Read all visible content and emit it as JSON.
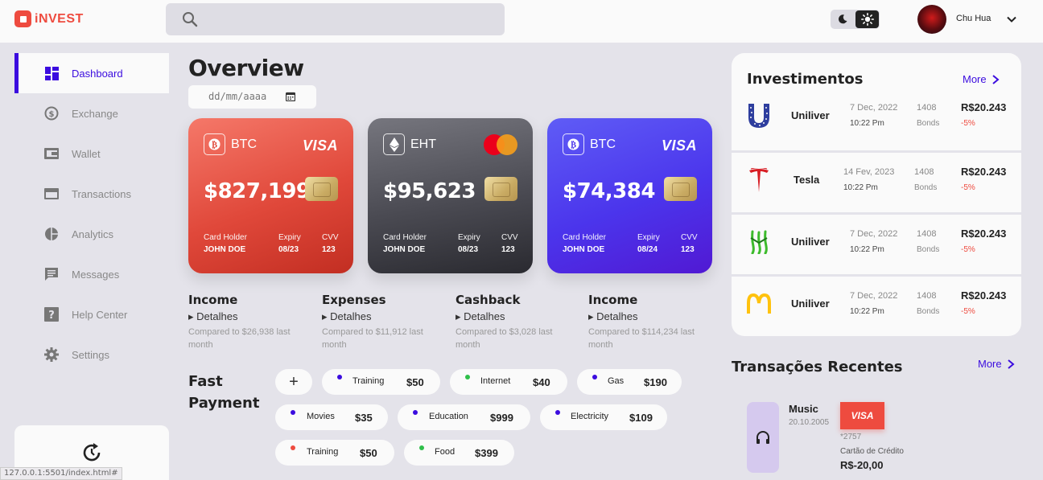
{
  "app": {
    "name": "iNVEST",
    "brand_color": "#ee4b3f",
    "accent_color": "#3b0cdf"
  },
  "header": {
    "user_name": "Chu Hua",
    "search_icon": "search-icon",
    "theme_icons": [
      "moon-icon",
      "sun-icon"
    ]
  },
  "sidebar": {
    "items": [
      {
        "label": "Dashboard",
        "icon": "dashboard-icon",
        "active": true
      },
      {
        "label": "Exchange",
        "icon": "exchange-icon"
      },
      {
        "label": "Wallet",
        "icon": "wallet-icon"
      },
      {
        "label": "Transactions",
        "icon": "card-icon"
      },
      {
        "label": "Analytics",
        "icon": "pie-chart-icon"
      },
      {
        "label": "Messages",
        "icon": "message-icon"
      },
      {
        "label": "Help Center",
        "icon": "help-icon"
      },
      {
        "label": "Settings",
        "icon": "gear-icon"
      }
    ]
  },
  "status_url": "127.0.0.1:5501/index.html#",
  "overview": {
    "title": "Overview",
    "date_placeholder": "dd/mm/aaaa",
    "cards": [
      {
        "coin": "BTC",
        "brand": "VISA",
        "amount": "$827,199",
        "holder_label": "Card Holder",
        "holder": "JOHN DOE",
        "expiry_label": "Expiry",
        "expiry": "08/23",
        "cvv_label": "CVV",
        "cvv": "123"
      },
      {
        "coin": "EHT",
        "brand": "mastercard",
        "amount": "$95,623",
        "holder_label": "Card Holder",
        "holder": "JOHN DOE",
        "expiry_label": "Expiry",
        "expiry": "08/23",
        "cvv_label": "CVV",
        "cvv": "123"
      },
      {
        "coin": "BTC",
        "brand": "VISA",
        "amount": "$74,384",
        "holder_label": "Card Holder",
        "holder": "JOHN DOE",
        "expiry_label": "Expiry",
        "expiry": "08/24",
        "cvv_label": "CVV",
        "cvv": "123"
      }
    ],
    "stats": [
      {
        "title": "Income",
        "details": "Detalhes",
        "compare": "Compared to $26,938 last month"
      },
      {
        "title": "Expenses",
        "details": "Detalhes",
        "compare": "Compared to $11,912 last month"
      },
      {
        "title": "Cashback",
        "details": "Detalhes",
        "compare": "Compared to $3,028 last month"
      },
      {
        "title": "Income",
        "details": "Detalhes",
        "compare": "Compared to $114,234 last month"
      }
    ]
  },
  "fast_payment": {
    "title_line1": "Fast",
    "title_line2": "Payment",
    "add_label": "+",
    "items": [
      {
        "name": "Training",
        "price": "$50",
        "color": "#3b0cdf"
      },
      {
        "name": "Internet",
        "price": "$40",
        "color": "#2fbf4a"
      },
      {
        "name": "Gas",
        "price": "$190",
        "color": "#3b0cdf"
      },
      {
        "name": "Movies",
        "price": "$35",
        "color": "#3b0cdf"
      },
      {
        "name": "Education",
        "price": "$999",
        "color": "#3b0cdf"
      },
      {
        "name": "Electricity",
        "price": "$109",
        "color": "#3b0cdf"
      },
      {
        "name": "Training",
        "price": "$50",
        "color": "#ee4b3f"
      },
      {
        "name": "Food",
        "price": "$399",
        "color": "#2fbf4a"
      }
    ]
  },
  "investments": {
    "title": "Investimentos",
    "more": "More",
    "rows": [
      {
        "logo": "unilever-logo-icon",
        "name": "Uniliver",
        "date": "7 Dec, 2022",
        "time": "10:22 Pm",
        "qty": "1408",
        "qty_label": "Bonds",
        "price": "R$20.243",
        "change": "-5%"
      },
      {
        "logo": "tesla-logo-icon",
        "name": "Tesla",
        "date": "14 Fev, 2023",
        "time": "10:22 Pm",
        "qty": "1408",
        "qty_label": "Bonds",
        "price": "R$20.243",
        "change": "-5%"
      },
      {
        "logo": "monster-logo-icon",
        "name": "Uniliver",
        "date": "7 Dec, 2022",
        "time": "10:22 Pm",
        "qty": "1408",
        "qty_label": "Bonds",
        "price": "R$20.243",
        "change": "-5%"
      },
      {
        "logo": "mcdonalds-logo-icon",
        "name": "Uniliver",
        "date": "7 Dec, 2022",
        "time": "10:22 Pm",
        "qty": "1408",
        "qty_label": "Bonds",
        "price": "R$20.243",
        "change": "-5%"
      }
    ]
  },
  "transactions": {
    "title": "Transações Recentes",
    "more": "More",
    "item": {
      "name": "Music",
      "date": "20.10.2005",
      "brand": "VISA",
      "number": "*2757",
      "type": "Cartão de Crédito",
      "amount": "R$-20,00",
      "icon": "headphones-icon"
    }
  }
}
